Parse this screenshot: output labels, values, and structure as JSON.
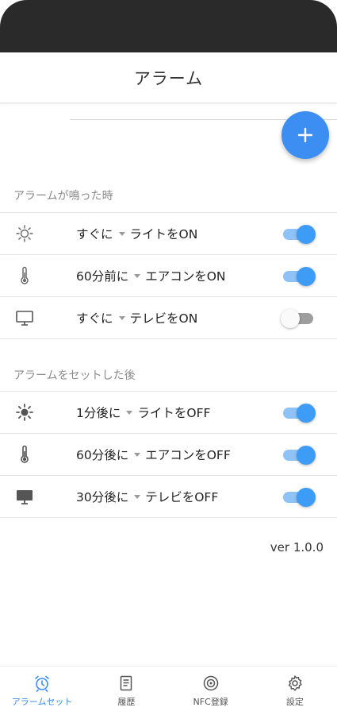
{
  "app_bar": {
    "title": "アラーム"
  },
  "fab": {
    "icon": "plus-icon"
  },
  "colors": {
    "accent": "#3d8ef3",
    "toggle_on": "#3d9cf5",
    "toggle_off": "#9e9e9e"
  },
  "section_ringing": {
    "header": "アラームが鳴った時",
    "rows": [
      {
        "icon": "sun-outline-icon",
        "timing": "すぐに",
        "action": "ライトをON",
        "enabled": true
      },
      {
        "icon": "thermometer-icon",
        "timing": "60分前に",
        "action": "エアコンをON",
        "enabled": true
      },
      {
        "icon": "tv-icon",
        "timing": "すぐに",
        "action": "テレビをON",
        "enabled": false
      }
    ]
  },
  "section_after_set": {
    "header": "アラームをセットした後",
    "rows": [
      {
        "icon": "sun-filled-icon",
        "timing": "1分後に",
        "action": "ライトをOFF",
        "enabled": true
      },
      {
        "icon": "thermometer-icon",
        "timing": "60分後に",
        "action": "エアコンをOFF",
        "enabled": true
      },
      {
        "icon": "tv-filled-icon",
        "timing": "30分後に",
        "action": "テレビをOFF",
        "enabled": true
      }
    ]
  },
  "version": "ver 1.0.0",
  "bottom_nav": {
    "items": [
      {
        "label": "アラームセット",
        "icon": "alarm-clock-icon",
        "active": true
      },
      {
        "label": "履歴",
        "icon": "history-icon",
        "active": false
      },
      {
        "label": "NFC登録",
        "icon": "nfc-icon",
        "active": false
      },
      {
        "label": "設定",
        "icon": "gear-icon",
        "active": false
      }
    ]
  }
}
